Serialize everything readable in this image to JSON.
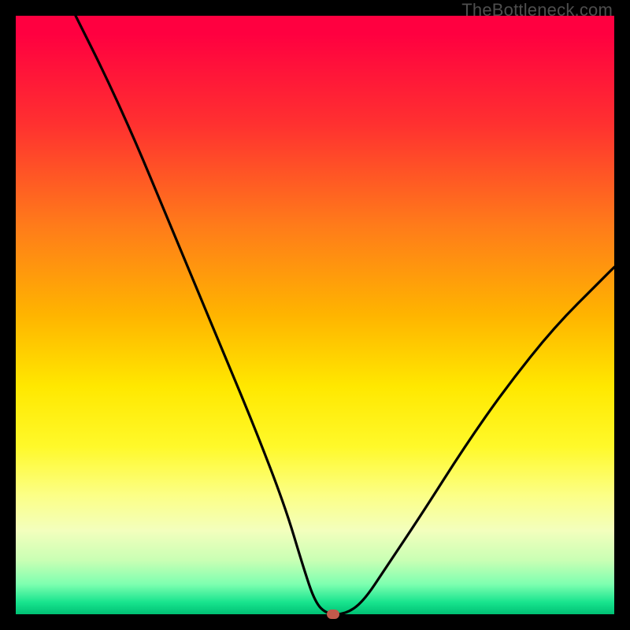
{
  "watermark": "TheBottleneck.com",
  "chart_data": {
    "type": "line",
    "title": "",
    "xlabel": "",
    "ylabel": "",
    "xlim": [
      0,
      100
    ],
    "ylim": [
      0,
      100
    ],
    "grid": false,
    "legend": false,
    "background_gradient": {
      "direction": "vertical",
      "stops": [
        {
          "pos": 0,
          "color": "#ff0040"
        },
        {
          "pos": 50,
          "color": "#ffe800"
        },
        {
          "pos": 100,
          "color": "#00c074"
        }
      ]
    },
    "series": [
      {
        "name": "bottleneck-curve",
        "color": "#000000",
        "x": [
          10,
          15,
          20,
          25,
          30,
          35,
          40,
          45,
          48,
          50,
          52,
          55,
          58,
          62,
          68,
          75,
          82,
          90,
          98,
          100
        ],
        "y": [
          100,
          90,
          79,
          67,
          55,
          43,
          31,
          18,
          8,
          2,
          0,
          0,
          2,
          8,
          17,
          28,
          38,
          48,
          56,
          58
        ]
      }
    ],
    "marker": {
      "x": 53,
      "y": 0,
      "color": "#c2594b"
    }
  }
}
